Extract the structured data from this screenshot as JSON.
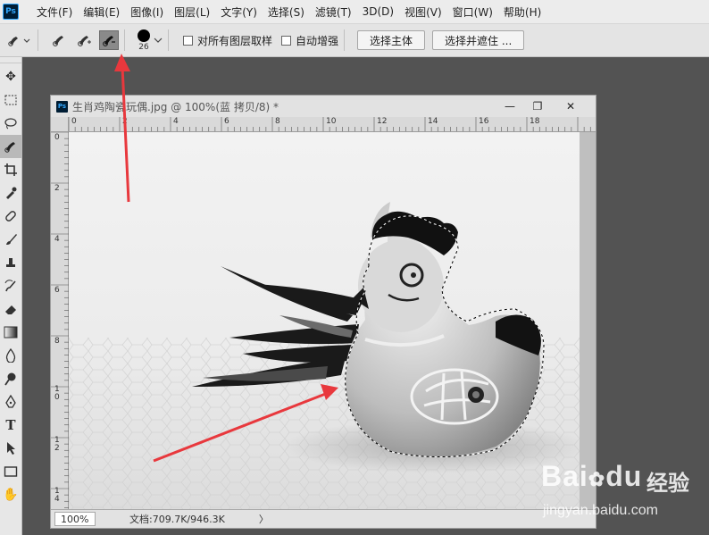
{
  "app": {
    "logo": "Ps"
  },
  "menu": [
    "文件(F)",
    "编辑(E)",
    "图像(I)",
    "图层(L)",
    "文字(Y)",
    "选择(S)",
    "滤镜(T)",
    "3D(D)",
    "视图(V)",
    "窗口(W)",
    "帮助(H)"
  ],
  "options": {
    "brush_size": "26",
    "sample_all_layers_label": "对所有图层取样",
    "sample_all_layers_checked": false,
    "auto_enhance_label": "自动增强",
    "auto_enhance_checked": false,
    "select_subject_label": "选择主体",
    "select_and_mask_label": "选择并遮住 ..."
  },
  "document": {
    "title": "生肖鸡陶瓷玩偶.jpg @ 100%(蓝 拷贝/8) *",
    "minimize": "—",
    "restore": "❐",
    "close": "✕",
    "ruler_h": [
      "0",
      "2",
      "4",
      "6",
      "8",
      "10",
      "12",
      "14",
      "16",
      "18"
    ],
    "ruler_v": [
      "0",
      "2",
      "4",
      "6",
      "8",
      "1\n0",
      "1\n2",
      "1\n4"
    ]
  },
  "status": {
    "zoom": "100%",
    "doc_info": "文档:709.7K/946.3K",
    "arrow": "〉"
  },
  "watermark": {
    "brand": "Bai",
    "brand2": "du",
    "cn": "经验",
    "url": "jingyan.baidu.com"
  },
  "colors": {
    "arrow": "#e8383d",
    "selection": "#000000",
    "accent": "#31a8ff"
  },
  "icons": {
    "tools": [
      "move-icon",
      "marquee-icon",
      "lasso-icon",
      "quick-select-icon",
      "crop-icon",
      "eyedropper-icon",
      "healing-brush-icon",
      "brush-icon",
      "stamp-icon",
      "history-brush-icon",
      "eraser-icon",
      "gradient-icon",
      "blur-icon",
      "dodge-icon",
      "pen-icon",
      "type-icon",
      "path-select-icon",
      "rectangle-icon",
      "hand-icon"
    ]
  }
}
